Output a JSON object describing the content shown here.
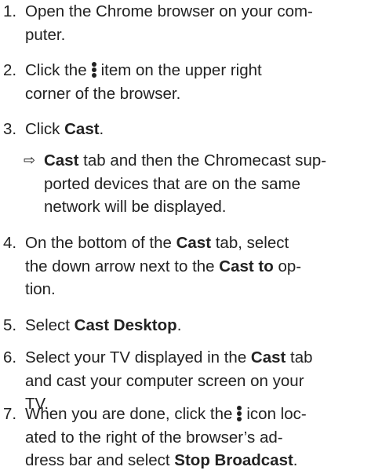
{
  "steps": [
    {
      "number": "1.",
      "lines": [
        "Open the Chrome browser on your com-",
        "puter."
      ]
    },
    {
      "number": "2.",
      "line1_before": "Click the",
      "line1_after": "item on the upper right",
      "line2": "corner of the browser."
    },
    {
      "number": "3.",
      "before": "Click ",
      "bold": "Cast",
      "after": "."
    },
    {
      "arrow": "⇨",
      "bold": "Cast",
      "line1_after": " tab and then the Chromecast sup-",
      "line2": "ported devices that are on the same",
      "line3": "network will be displayed."
    },
    {
      "number": "4.",
      "line1_before": "On the bottom of the ",
      "line1_bold": "Cast",
      "line1_after": " tab, select",
      "line2_before": "the down arrow next to the ",
      "line2_bold": "Cast to",
      "line2_after": " op-",
      "line3": "tion."
    },
    {
      "number": "5.",
      "before": "Select ",
      "bold": "Cast Desktop",
      "after": "."
    },
    {
      "number": "6.",
      "line1_before": "Select your TV displayed in the ",
      "line1_bold": "Cast",
      "line1_after": " tab",
      "line2": "and cast your computer screen on your",
      "line3": "TV."
    },
    {
      "number": "7.",
      "line1_before": "When you are done, click the",
      "line1_after": "icon loc-",
      "line2": "ated to the right of the browser’s ad-",
      "line3_before": "dress bar and select ",
      "line3_bold": "Stop Broadcast",
      "line3_after": "."
    }
  ]
}
